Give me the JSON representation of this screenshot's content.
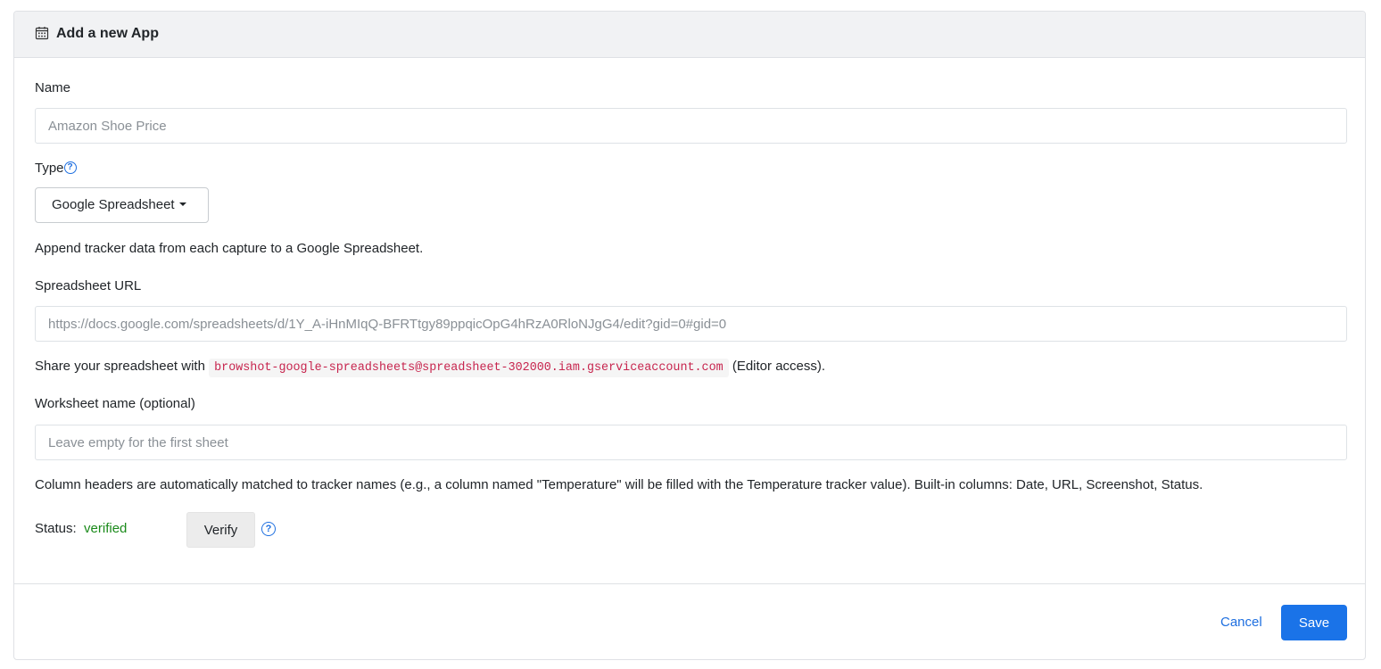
{
  "header": {
    "icon": "calendar-icon",
    "title": "Add a new App"
  },
  "form": {
    "name_label": "Name",
    "name_placeholder": "Amazon Shoe Price",
    "type_label": "Type",
    "type_help_icon": "question-circle-icon",
    "type_selected": "Google Spreadsheet",
    "type_description": "Append tracker data from each capture to a Google Spreadsheet.",
    "url_label": "Spreadsheet URL",
    "url_placeholder": "https://docs.google.com/spreadsheets/d/1Y_A-iHnMIqQ-BFRTtgy89ppqicOpG4hRzA0RloNJgG4/edit?gid=0#gid=0",
    "share_prefix": "Share your spreadsheet with",
    "share_email": "browshot-google-spreadsheets@spreadsheet-302000.iam.gserviceaccount.com",
    "share_suffix": "(Editor access).",
    "worksheet_label": "Worksheet name (optional)",
    "worksheet_placeholder": "Leave empty for the first sheet",
    "columns_note": "Column headers are automatically matched to tracker names (e.g., a column named \"Temperature\" will be filled with the Temperature tracker value). Built-in columns: Date, URL, Screenshot, Status.",
    "status_label": "Status:",
    "status_value": "verified",
    "verify_label": "Verify",
    "verify_help_icon": "question-circle-icon"
  },
  "footer": {
    "cancel_label": "Cancel",
    "save_label": "Save"
  },
  "colors": {
    "accent": "#1a73e8",
    "status_ok": "#1a8a1a",
    "code_text": "#c7254e"
  }
}
